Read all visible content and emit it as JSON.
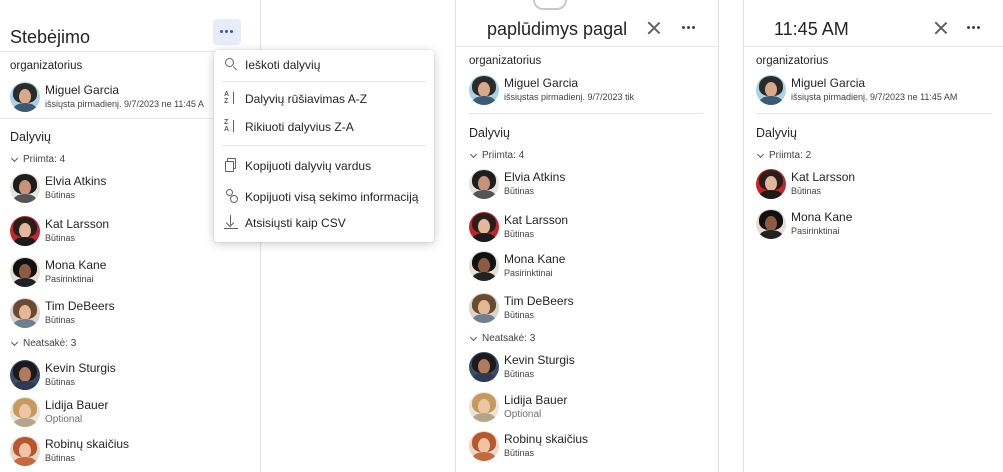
{
  "colors": {
    "accent": "#3a4fd1",
    "menu_hover": "#e8ebfa",
    "divider": "#e1e1e1"
  },
  "panel1": {
    "title": "Stebėjimo",
    "organizer_label": "organizatorius",
    "organizer_name": "Miguel Garcia",
    "organizer_sub": "išsiųsta pirmadienį. 9/7/2023 ne 11:45 A",
    "attendees_label": "Dalyvių",
    "accepted_label": "Priimta: 4",
    "noresponse_label": "Neatsakė: 3",
    "people": [
      {
        "name": "Elvia Atkins",
        "role": "Būtinas"
      },
      {
        "name": "Kat Larsson",
        "role": "Būtinas"
      },
      {
        "name": "Mona Kane",
        "role": "Pasirinktinai"
      },
      {
        "name": "Tim DeBeers",
        "role": "Būtinas"
      },
      {
        "name": "Kevin Sturgis",
        "role": "Būtinas"
      },
      {
        "name": "Lidija Bauer",
        "role": "Optional"
      },
      {
        "name": "Robinų skaičius",
        "role": "Būtinas"
      }
    ],
    "more_icon": "more-horizontal-icon"
  },
  "menu": {
    "items": [
      {
        "label": "Ieškoti dalyvių",
        "icon": "search-icon"
      },
      {
        "label": "Dalyvių rūšiavimas A-Z",
        "icon": "sort-ascending-icon"
      },
      {
        "label": "Rikiuoti dalyvius Z-A",
        "icon": "sort-descending-icon"
      },
      {
        "label": "Kopijuoti dalyvių vardus",
        "icon": "copy-icon"
      },
      {
        "label": "Kopijuoti visą sekimo informaciją",
        "icon": "copy-all-icon"
      },
      {
        "label": "Atsisiųsti kaip CSV",
        "icon": "download-icon"
      }
    ]
  },
  "panel2": {
    "title": "paplūdimys pagal",
    "organizer_label": "organizatorius",
    "organizer_name": "Miguel Garcia",
    "organizer_sub": "išsiųstas pirmadienį. 9/7/2023 tik",
    "attendees_label": "Dalyvių",
    "accepted_label": "Priimta: 4",
    "noresponse_label": "Neatsakė: 3",
    "people": [
      {
        "name": "Elvia Atkins",
        "role": "Būtinas"
      },
      {
        "name": "Kat Larsson",
        "role": "Būtinas"
      },
      {
        "name": "Mona Kane",
        "role": "Pasirinktinai"
      },
      {
        "name": "Tim DeBeers",
        "role": "Būtinas"
      },
      {
        "name": "Kevin Sturgis",
        "role": "Būtinas"
      },
      {
        "name": "Lidija Bauer",
        "role": "Optional"
      },
      {
        "name": "Robinų skaičius",
        "role": "Būtinas"
      }
    ]
  },
  "panel3": {
    "title": "11:45 AM",
    "organizer_label": "organizatorius",
    "organizer_name": "Miguel Garcia",
    "organizer_sub": "išsiųsta pirmadienį. 9/7/2023 ne 11:45 AM",
    "attendees_label": "Dalyvių",
    "accepted_label": "Priimta: 2",
    "people": [
      {
        "name": "Kat Larsson",
        "role": "Būtinas"
      },
      {
        "name": "Mona Kane",
        "role": "Pasirinktinai"
      }
    ]
  }
}
